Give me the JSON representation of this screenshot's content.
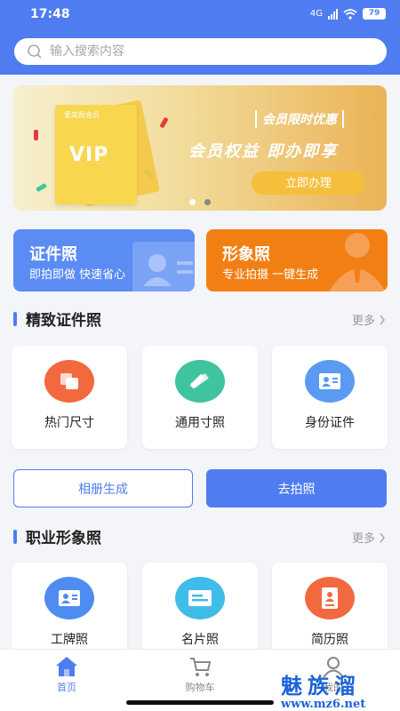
{
  "status_bar": {
    "time": "17:48",
    "network": "4G",
    "battery": "79"
  },
  "search": {
    "placeholder": "输入搜索内容"
  },
  "banner": {
    "card_title": "爱美照会员",
    "card_badge": "VIP",
    "promo_tag": "会员限时优惠",
    "slogan": "会员权益  即办即享",
    "button_label": "立即办理",
    "page_count": 2,
    "active_page": 1
  },
  "categories": [
    {
      "title": "证件照",
      "subtitle": "即拍即做 快速省心",
      "color": "#5b8cf3"
    },
    {
      "title": "形象照",
      "subtitle": "专业拍摄 一键生成",
      "color": "#f27f14"
    }
  ],
  "section_id": {
    "title": "精致证件照",
    "more": "更多",
    "tiles": [
      {
        "label": "热门尺寸",
        "icon": "photos-icon",
        "color": "#f2693f"
      },
      {
        "label": "通用寸照",
        "icon": "pencil-ruler-icon",
        "color": "#3fc4a0"
      },
      {
        "label": "身份证件",
        "icon": "id-card-icon",
        "color": "#5b9af2"
      }
    ]
  },
  "actions": {
    "album": "相册生成",
    "shoot": "去拍照"
  },
  "section_career": {
    "title": "职业形象照",
    "more": "更多",
    "tiles": [
      {
        "label": "工牌照",
        "icon": "badge-card-icon",
        "color": "#4f8cf2"
      },
      {
        "label": "名片照",
        "icon": "business-card-icon",
        "color": "#3fbcea"
      },
      {
        "label": "简历照",
        "icon": "resume-icon",
        "color": "#f2693f"
      }
    ]
  },
  "tabbar": {
    "items": [
      {
        "label": "首页",
        "icon": "home-icon",
        "active": true
      },
      {
        "label": "购物车",
        "icon": "cart-icon",
        "active": false
      },
      {
        "label": "我的",
        "icon": "profile-icon",
        "active": false
      }
    ]
  },
  "watermark": {
    "text": "魅族溜",
    "url": "www.mz6.net"
  },
  "colors": {
    "primary": "#4f7df1",
    "banner_gold": "#f5bf3b"
  }
}
